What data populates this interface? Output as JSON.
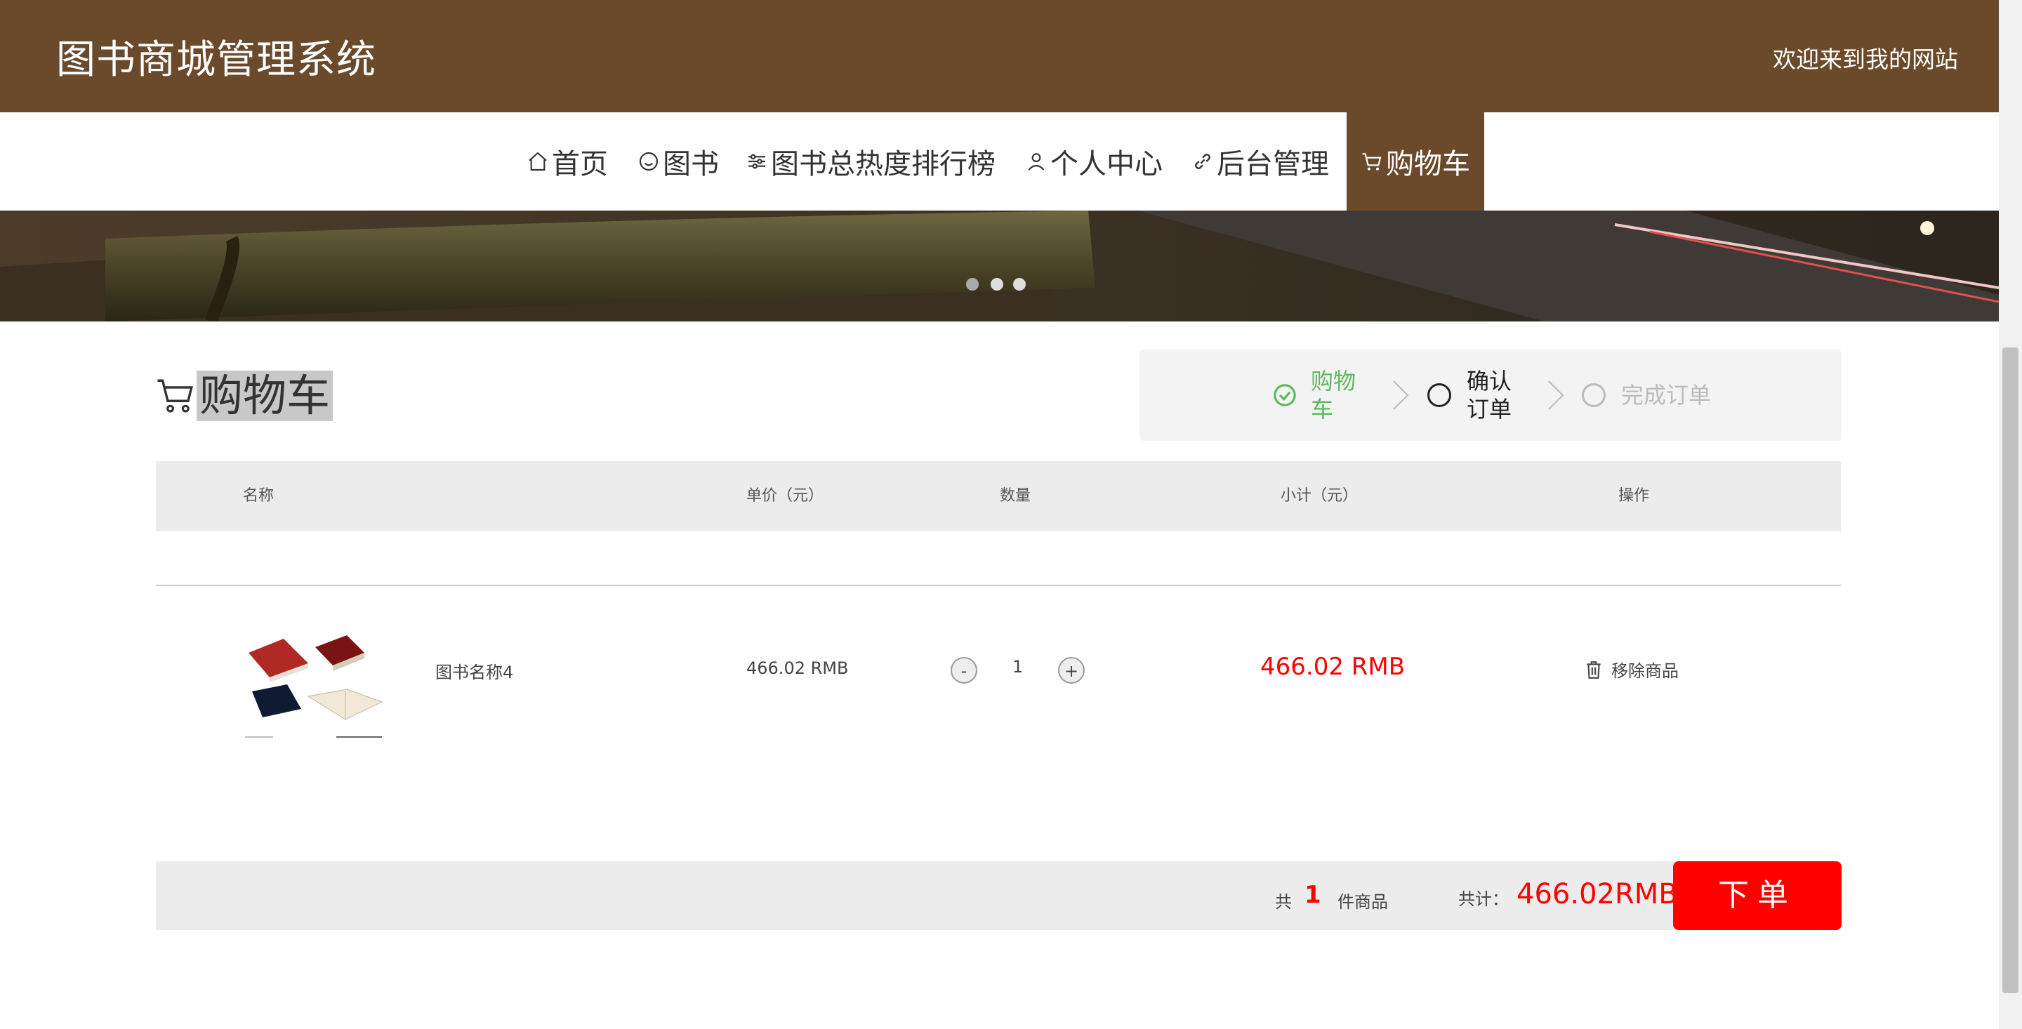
{
  "header": {
    "title": "图书商城管理系统",
    "welcome": "欢迎来到我的网站"
  },
  "nav": {
    "items": [
      {
        "label": "首页",
        "icon": "home-icon"
      },
      {
        "label": "图书",
        "icon": "smile-icon"
      },
      {
        "label": "图书总热度排行榜",
        "icon": "sliders-icon"
      },
      {
        "label": "个人中心",
        "icon": "user-icon"
      },
      {
        "label": "后台管理",
        "icon": "link-icon"
      },
      {
        "label": "购物车",
        "icon": "cart-icon",
        "active": true
      }
    ]
  },
  "cart": {
    "title": "购物车",
    "steps": [
      {
        "label": "购物车",
        "state": "done"
      },
      {
        "label": "确认订单",
        "state": "current"
      },
      {
        "label": "完成订单",
        "state": "pending"
      }
    ],
    "columns": [
      "名称",
      "单价（元）",
      "数量",
      "小计（元）",
      "操作"
    ],
    "items": [
      {
        "name": "图书名称4",
        "price": "466.02 RMB",
        "qty": "1",
        "subtotal": "466.02 RMB",
        "remove": "移除商品"
      }
    ],
    "qty_minus": "-",
    "qty_plus": "+",
    "summary": {
      "prefix": "共",
      "count": "1",
      "suffix": "件商品",
      "total_label": "共计：",
      "total": "466.02RMB"
    },
    "order_button": "下单"
  },
  "colors": {
    "brand": "#6b4a2b",
    "accent_red": "#ff0000",
    "done_green": "#5cb85c"
  }
}
